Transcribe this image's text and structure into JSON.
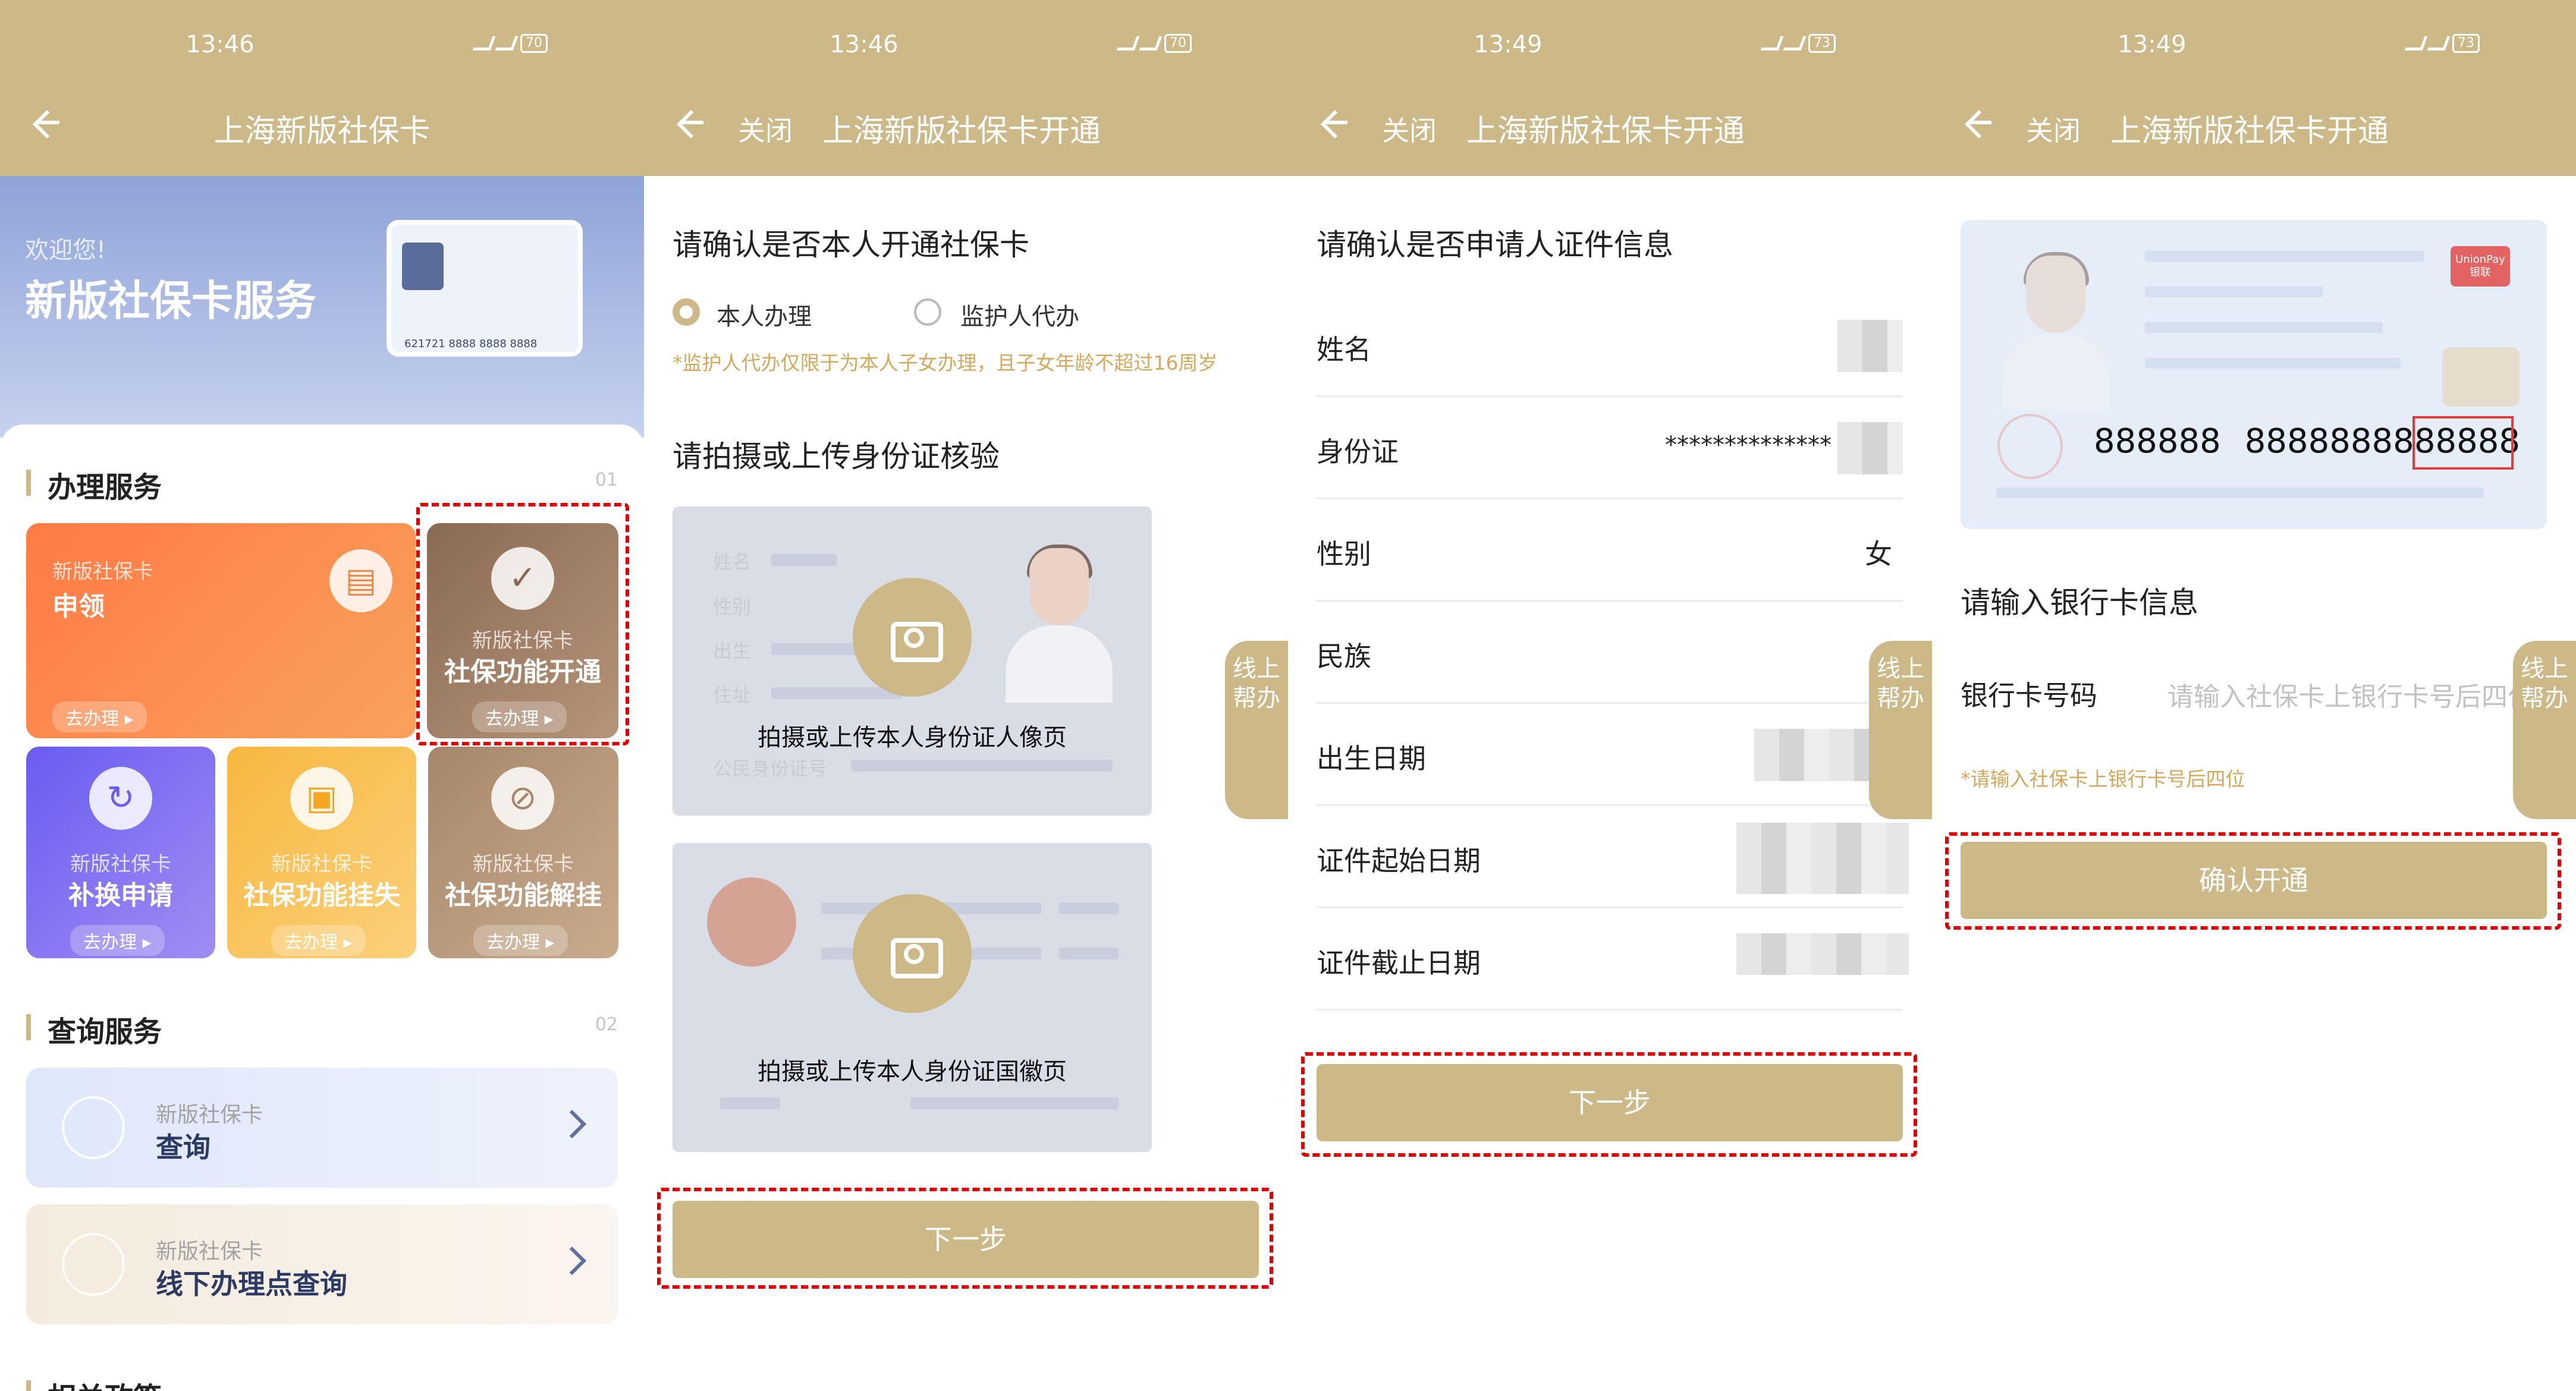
{
  "status": {
    "time1": "13:46",
    "time2": "13:46",
    "time3": "13:49",
    "time4": "13:49",
    "batt1": "70",
    "batt2": "70",
    "batt3": "73",
    "batt4": "73"
  },
  "p1": {
    "title": "上海新版社保卡",
    "welcome": "欢迎您!",
    "banner_title": "新版社保卡服务",
    "card_number": "621721 8888 8888 8888",
    "sec1": "办理服务",
    "sec1_num": "01",
    "tiles": [
      {
        "sub": "新版社保卡",
        "name": "申领",
        "go": "去办理 ▸"
      },
      {
        "sub": "新版社保卡",
        "name": "社保功能开通",
        "go": "去办理 ▸"
      },
      {
        "sub": "新版社保卡",
        "name": "补换申请",
        "go": "去办理 ▸"
      },
      {
        "sub": "新版社保卡",
        "name": "社保功能挂失",
        "go": "去办理 ▸"
      },
      {
        "sub": "新版社保卡",
        "name": "社保功能解挂",
        "go": "去办理 ▸"
      }
    ],
    "sec2": "查询服务",
    "sec2_num": "02",
    "queries": [
      {
        "sub": "新版社保卡",
        "name": "查询"
      },
      {
        "sub": "新版社保卡",
        "name": "线下办理点查询"
      }
    ],
    "sec3": "相关政策"
  },
  "p2": {
    "close": "关闭",
    "title": "上海新版社保卡开通",
    "q1": "请确认是否本人开通社保卡",
    "opt_self": "本人办理",
    "opt_guardian": "监护人代办",
    "note": "*监护人代办仅限于为本人子女办理，且子女年龄不超过16周岁",
    "q2": "请拍摄或上传身份证核验",
    "ghost_fields": [
      "姓名",
      "性别",
      "出生",
      "住址",
      "公民身份证号"
    ],
    "upload1": "拍摄或上传本人身份证人像页",
    "upload2": "拍摄或上传本人身份证国徽页",
    "next": "下一步",
    "help": "线上帮办"
  },
  "p3": {
    "close": "关闭",
    "title": "上海新版社保卡开通",
    "heading": "请确认是否申请人证件信息",
    "fields": [
      {
        "label": "姓名",
        "value": ""
      },
      {
        "label": "身份证",
        "value": "**************"
      },
      {
        "label": "性别",
        "value": "女"
      },
      {
        "label": "民族",
        "value": ""
      },
      {
        "label": "出生日期",
        "value": ""
      },
      {
        "label": "证件起始日期",
        "value": ""
      },
      {
        "label": "证件截止日期",
        "value": ""
      }
    ],
    "next": "下一步",
    "help": "线上帮办"
  },
  "p4": {
    "close": "关闭",
    "title": "上海新版社保卡开通",
    "card_num_a": "888888",
    "card_num_b": "888888888",
    "card_num_c": "8888",
    "unionpay": "UnionPay 银联",
    "heading": "请输入银行卡信息",
    "field_label": "银行卡号码",
    "placeholder": "请输入社保卡上银行卡号后四位",
    "note": "*请输入社保卡上银行卡号后四位",
    "confirm": "确认开通",
    "help": "线上帮办"
  },
  "colors": {
    "gold": "#cdb887",
    "highlight_red": "#e00000"
  }
}
